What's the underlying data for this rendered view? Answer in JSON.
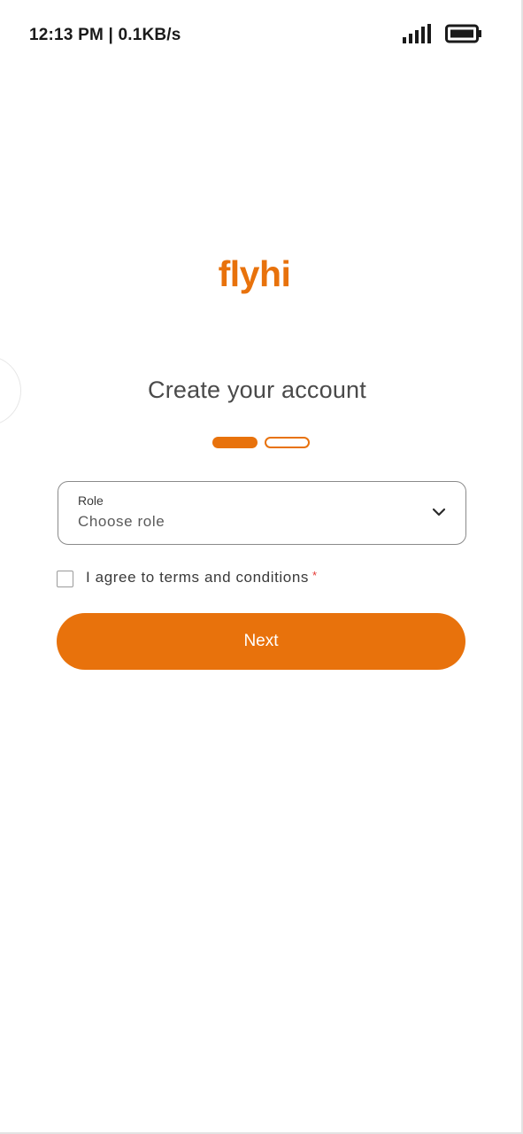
{
  "status_bar": {
    "time_speed": "12:13 PM | 0.1KB/s",
    "signal_icon": "signal-bars-icon",
    "battery_icon": "battery-icon"
  },
  "brand": {
    "logo_text": "flyhi",
    "accent_color": "#e8720c"
  },
  "page": {
    "title": "Create your account"
  },
  "stepper": {
    "current_step": 1,
    "total_steps": 2
  },
  "form": {
    "role": {
      "label": "Role",
      "value": "Choose role",
      "icon": "chevron-down-icon"
    },
    "terms": {
      "label": "I agree to terms and conditions",
      "required_mark": "*",
      "checked": false
    },
    "next_label": "Next"
  }
}
